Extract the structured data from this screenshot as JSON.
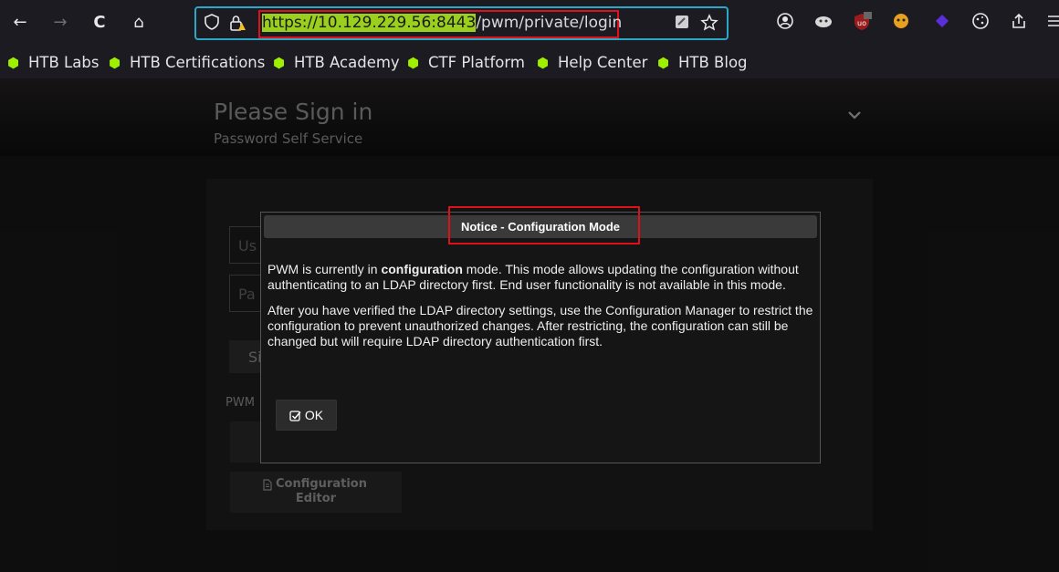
{
  "browser": {
    "url_host": "https://10.129.229.56:8443",
    "url_path": "/pwm/private/login",
    "nav_back_icon": "←",
    "nav_forward_icon": "→",
    "reload_icon": "C",
    "home_icon": "⌂"
  },
  "bookmarks": [
    {
      "label": "HTB Labs"
    },
    {
      "label": "HTB Certifications"
    },
    {
      "label": "HTB Academy"
    },
    {
      "label": "CTF Platform"
    },
    {
      "label": "Help Center"
    },
    {
      "label": "HTB Blog"
    }
  ],
  "page": {
    "title": "Please Sign in",
    "subtitle": "Password Self Service",
    "username_placeholder_fragment": "Us",
    "password_placeholder_fragment": "Pa",
    "signin_fragment": "Si",
    "pwm_label_fragment": "PWM",
    "config_editor_label_line1": "Configuration",
    "config_editor_label_line2": "Editor"
  },
  "dialog": {
    "title": "Notice - Configuration Mode",
    "para1_pre": "PWM is currently in ",
    "para1_bold": "configuration",
    "para1_post": " mode. This mode allows updating the configuration without authenticating to an LDAP directory first. End user functionality is not available in this mode.",
    "para2": "After you have verified the LDAP directory settings, use the Configuration Manager to restrict the configuration to prevent unauthorized changes. After restricting, the configuration can still be changed but will require LDAP directory authentication first.",
    "ok_label": "OK"
  },
  "colors": {
    "url_highlight_border": "#e0101a",
    "url_host_bg": "#9bcf1e",
    "bookmark_icon": "#9fef00",
    "urlbar_border": "#2ba8c8"
  }
}
